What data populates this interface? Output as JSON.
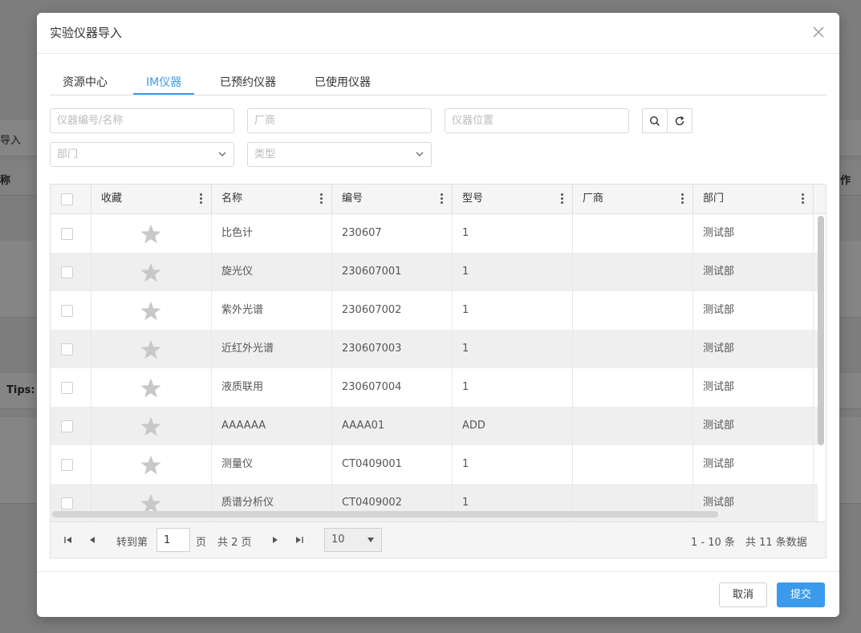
{
  "background": {
    "import_label": "导入",
    "name_col_fragment": "称",
    "action_col_fragment": "作",
    "tips_label": "Tips:"
  },
  "modal": {
    "title": "实验仪器导入"
  },
  "tabs": [
    {
      "label": "资源中心",
      "active": false
    },
    {
      "label": "IM仪器",
      "active": true
    },
    {
      "label": "已预约仪器",
      "active": false
    },
    {
      "label": "已使用仪器",
      "active": false
    }
  ],
  "filters": {
    "code_name_placeholder": "仪器编号/名称",
    "vendor_placeholder": "厂商",
    "location_placeholder": "仪器位置",
    "department_placeholder": "部门",
    "type_placeholder": "类型"
  },
  "table": {
    "columns": [
      "收藏",
      "名称",
      "编号",
      "型号",
      "厂商",
      "部门"
    ],
    "rows": [
      {
        "name": "比色计",
        "code": "230607",
        "model": "1",
        "vendor": "",
        "department": "测试部"
      },
      {
        "name": "旋光仪",
        "code": "230607001",
        "model": "1",
        "vendor": "",
        "department": "测试部"
      },
      {
        "name": "紫外光谱",
        "code": "230607002",
        "model": "1",
        "vendor": "",
        "department": "测试部"
      },
      {
        "name": "近红外光谱",
        "code": "230607003",
        "model": "1",
        "vendor": "",
        "department": "测试部"
      },
      {
        "name": "液质联用",
        "code": "230607004",
        "model": "1",
        "vendor": "",
        "department": "测试部"
      },
      {
        "name": "AAAAAA",
        "code": "AAAA01",
        "model": "ADD",
        "vendor": "",
        "department": "测试部"
      },
      {
        "name": "测量仪",
        "code": "CT0409001",
        "model": "1",
        "vendor": "",
        "department": "测试部"
      },
      {
        "name": "质谱分析仪",
        "code": "CT0409002",
        "model": "1",
        "vendor": "",
        "department": "测试部"
      }
    ]
  },
  "pager": {
    "goto_label": "转到第",
    "page_value": "1",
    "page_unit": "页",
    "total_pages": "共 2 页",
    "page_size": "10",
    "range": "1 - 10 条",
    "total": "共 11 条数据"
  },
  "footer": {
    "cancel_label": "取消",
    "submit_label": "提交"
  },
  "colors": {
    "accent": "#3a9bec",
    "star": "#c8c8c8"
  }
}
